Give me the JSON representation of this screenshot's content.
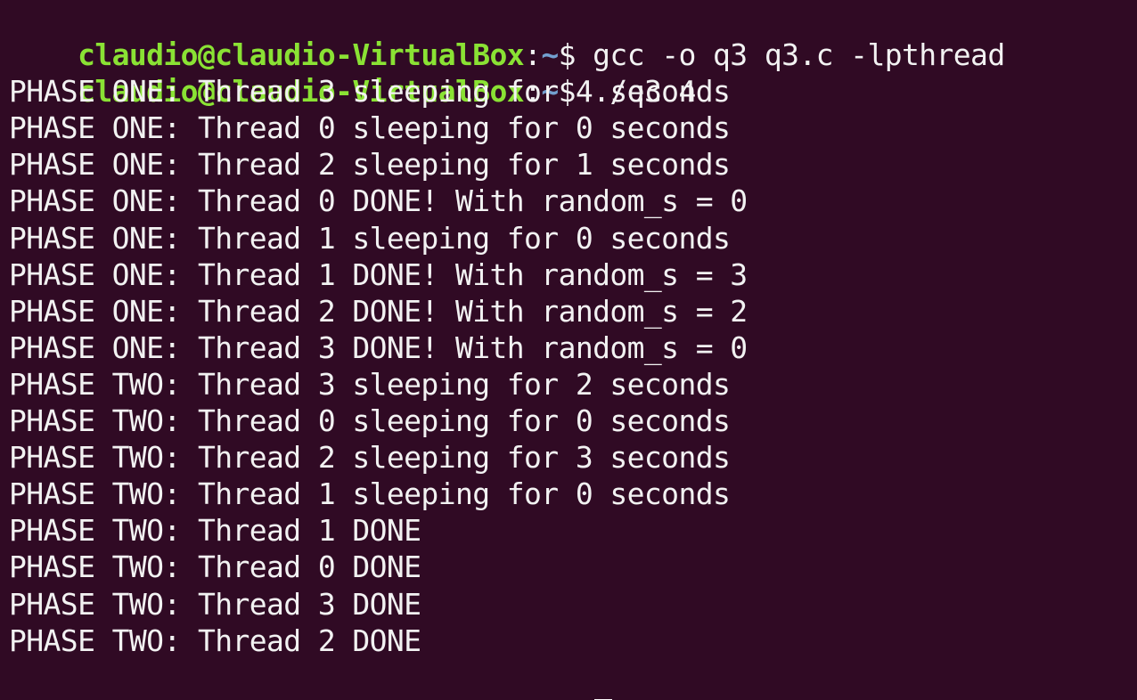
{
  "theme": {
    "background": "#300a24",
    "foreground": "#f2f2f2",
    "prompt_user_color": "#8ae234",
    "prompt_path_color": "#729fcf",
    "cursor_color": "#ffffff"
  },
  "prompt": {
    "user_host": "claudio@claudio-VirtualBox",
    "colon": ":",
    "path": "~",
    "dollar": "$ "
  },
  "commands": [
    "gcc -o q3 q3.c -lpthread",
    "./q3 4"
  ],
  "output": [
    "PHASE ONE: Thread 3 sleeping for 4 seconds",
    "PHASE ONE: Thread 0 sleeping for 0 seconds",
    "PHASE ONE: Thread 2 sleeping for 1 seconds",
    "PHASE ONE: Thread 0 DONE! With random_s = 0",
    "PHASE ONE: Thread 1 sleeping for 0 seconds",
    "PHASE ONE: Thread 1 DONE! With random_s = 3",
    "PHASE ONE: Thread 2 DONE! With random_s = 2",
    "PHASE ONE: Thread 3 DONE! With random_s = 0",
    "PHASE TWO: Thread 3 sleeping for 2 seconds",
    "PHASE TWO: Thread 0 sleeping for 0 seconds",
    "PHASE TWO: Thread 2 sleeping for 3 seconds",
    "PHASE TWO: Thread 1 sleeping for 0 seconds",
    "PHASE TWO: Thread 1 DONE",
    "PHASE TWO: Thread 0 DONE",
    "PHASE TWO: Thread 3 DONE",
    "PHASE TWO: Thread 2 DONE"
  ]
}
